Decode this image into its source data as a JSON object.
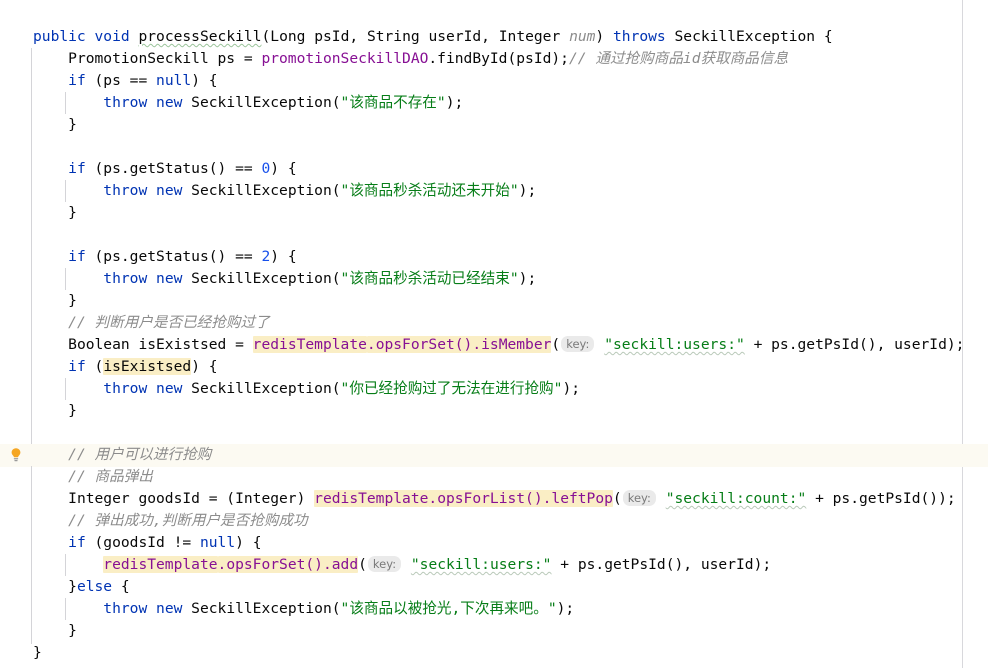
{
  "editor": {
    "language": "java",
    "theme": "IntelliJ Light",
    "colors": {
      "background": "#ffffff",
      "foreground": "#080808",
      "keyword": "#0033b3",
      "string": "#067d17",
      "number": "#1750eb",
      "comment": "#8c8c8c",
      "field": "#871094",
      "identifier_highlight": "#faeec5",
      "caret_row": "#fcfaf2",
      "inlay_hint_bg": "#eaeaea",
      "inlay_hint_fg": "#7a7a7a",
      "indent_guide": "#d4d4d8",
      "wrap_guide": "#d8d8dc",
      "bulb": "#f5a623"
    },
    "gutter": {
      "intention_bulb": "lightbulb-icon"
    }
  },
  "code": {
    "lines": [
      {
        "n": 1,
        "indent": 0,
        "tokens": [
          {
            "t": "public",
            "c": "kw"
          },
          {
            "t": " ",
            "c": "punct"
          },
          {
            "t": "void",
            "c": "kw"
          },
          {
            "t": " ",
            "c": "punct"
          },
          {
            "t": "processSeckill",
            "c": "ident wavy-green"
          },
          {
            "t": "(",
            "c": "punct"
          },
          {
            "t": "Long",
            "c": "type"
          },
          {
            "t": " psId, ",
            "c": "punct"
          },
          {
            "t": "String",
            "c": "type"
          },
          {
            "t": " userId, ",
            "c": "punct"
          },
          {
            "t": "Integer",
            "c": "type"
          },
          {
            "t": " ",
            "c": "punct"
          },
          {
            "t": "num",
            "c": "cmt-grey"
          },
          {
            "t": ") ",
            "c": "punct"
          },
          {
            "t": "throws",
            "c": "kw"
          },
          {
            "t": " SeckillException {",
            "c": "punct"
          }
        ]
      },
      {
        "n": 2,
        "indent": 1,
        "tokens": [
          {
            "t": "PromotionSeckill ps = ",
            "c": "punct"
          },
          {
            "t": "promotionSeckillDAO",
            "c": "field"
          },
          {
            "t": ".findById(psId);",
            "c": "punct"
          },
          {
            "t": "// ",
            "c": "cmt"
          },
          {
            "t": "通过抢购商品id获取商品信息",
            "c": "cmt cjk"
          }
        ]
      },
      {
        "n": 3,
        "indent": 1,
        "tokens": [
          {
            "t": "if",
            "c": "kw"
          },
          {
            "t": " (ps == ",
            "c": "punct"
          },
          {
            "t": "null",
            "c": "kw"
          },
          {
            "t": ") {",
            "c": "punct"
          }
        ]
      },
      {
        "n": 4,
        "indent": 2,
        "tokens": [
          {
            "t": "throw",
            "c": "kw"
          },
          {
            "t": " ",
            "c": "punct"
          },
          {
            "t": "new",
            "c": "kw"
          },
          {
            "t": " SeckillException(",
            "c": "punct"
          },
          {
            "t": "\"该商品不存在\"",
            "c": "str cjk"
          },
          {
            "t": ");",
            "c": "punct"
          }
        ]
      },
      {
        "n": 5,
        "indent": 1,
        "tokens": [
          {
            "t": "}",
            "c": "punct"
          }
        ]
      },
      {
        "n": 6,
        "indent": 0,
        "tokens": []
      },
      {
        "n": 7,
        "indent": 1,
        "tokens": [
          {
            "t": "if",
            "c": "kw"
          },
          {
            "t": " (ps.getStatus() == ",
            "c": "punct"
          },
          {
            "t": "0",
            "c": "num"
          },
          {
            "t": ") {",
            "c": "punct"
          }
        ]
      },
      {
        "n": 8,
        "indent": 2,
        "tokens": [
          {
            "t": "throw",
            "c": "kw"
          },
          {
            "t": " ",
            "c": "punct"
          },
          {
            "t": "new",
            "c": "kw"
          },
          {
            "t": " SeckillException(",
            "c": "punct"
          },
          {
            "t": "\"该商品秒杀活动还未开始\"",
            "c": "str cjk"
          },
          {
            "t": ");",
            "c": "punct"
          }
        ]
      },
      {
        "n": 9,
        "indent": 1,
        "tokens": [
          {
            "t": "}",
            "c": "punct"
          }
        ]
      },
      {
        "n": 10,
        "indent": 0,
        "tokens": []
      },
      {
        "n": 11,
        "indent": 1,
        "tokens": [
          {
            "t": "if",
            "c": "kw"
          },
          {
            "t": " (ps.getStatus() == ",
            "c": "punct"
          },
          {
            "t": "2",
            "c": "num"
          },
          {
            "t": ") {",
            "c": "punct"
          }
        ]
      },
      {
        "n": 12,
        "indent": 2,
        "tokens": [
          {
            "t": "throw",
            "c": "kw"
          },
          {
            "t": " ",
            "c": "punct"
          },
          {
            "t": "new",
            "c": "kw"
          },
          {
            "t": " SeckillException(",
            "c": "punct"
          },
          {
            "t": "\"该商品秒杀活动已经结束\"",
            "c": "str cjk"
          },
          {
            "t": ");",
            "c": "punct"
          }
        ]
      },
      {
        "n": 13,
        "indent": 1,
        "tokens": [
          {
            "t": "}",
            "c": "punct"
          }
        ]
      },
      {
        "n": 14,
        "indent": 1,
        "tokens": [
          {
            "t": "// ",
            "c": "cmt"
          },
          {
            "t": "判断用户是否已经抢购过了",
            "c": "cmt cjk"
          }
        ]
      },
      {
        "n": 15,
        "indent": 1,
        "tokens": [
          {
            "t": "Boolean isExistsed = ",
            "c": "punct"
          },
          {
            "t": "redisTemplate",
            "c": "field hl"
          },
          {
            "t": ".opsForSet().isMember",
            "c": "field hl"
          },
          {
            "t": "(",
            "c": "punct"
          },
          {
            "t": "key:",
            "c": "hint"
          },
          {
            "t": " ",
            "c": "punct"
          },
          {
            "t": "\"seckill:users:\"",
            "c": "str wavy-grey"
          },
          {
            "t": " + ps.getPsId(), userId);",
            "c": "punct"
          }
        ]
      },
      {
        "n": 16,
        "indent": 1,
        "tokens": [
          {
            "t": "if",
            "c": "kw"
          },
          {
            "t": " (",
            "c": "punct"
          },
          {
            "t": "isExistsed",
            "c": "ident hl"
          },
          {
            "t": ") {",
            "c": "punct"
          }
        ]
      },
      {
        "n": 17,
        "indent": 2,
        "tokens": [
          {
            "t": "throw",
            "c": "kw"
          },
          {
            "t": " ",
            "c": "punct"
          },
          {
            "t": "new",
            "c": "kw"
          },
          {
            "t": " SeckillException(",
            "c": "punct"
          },
          {
            "t": "\"你已经抢购过了无法在进行抢购\"",
            "c": "str cjk"
          },
          {
            "t": ");",
            "c": "punct"
          }
        ]
      },
      {
        "n": 18,
        "indent": 1,
        "tokens": [
          {
            "t": "}",
            "c": "punct"
          }
        ]
      },
      {
        "n": 19,
        "indent": 0,
        "tokens": []
      },
      {
        "n": 20,
        "indent": 1,
        "caret": true,
        "tokens": [
          {
            "t": "// ",
            "c": "cmt"
          },
          {
            "t": "用户可以进行抢购",
            "c": "cmt cjk"
          }
        ]
      },
      {
        "n": 21,
        "indent": 1,
        "tokens": [
          {
            "t": "// ",
            "c": "cmt"
          },
          {
            "t": "商品弹出",
            "c": "cmt cjk"
          }
        ]
      },
      {
        "n": 22,
        "indent": 1,
        "tokens": [
          {
            "t": "Integer goodsId = (Integer) ",
            "c": "punct"
          },
          {
            "t": "redisTemplate",
            "c": "field hl"
          },
          {
            "t": ".opsForList().leftPop",
            "c": "field hl"
          },
          {
            "t": "(",
            "c": "punct"
          },
          {
            "t": "key:",
            "c": "hint"
          },
          {
            "t": " ",
            "c": "punct"
          },
          {
            "t": "\"seckill:count:\"",
            "c": "str wavy-grey"
          },
          {
            "t": " + ps.getPsId());",
            "c": "punct"
          }
        ]
      },
      {
        "n": 23,
        "indent": 1,
        "tokens": [
          {
            "t": "// ",
            "c": "cmt"
          },
          {
            "t": "弹出成功,判断用户是否抢购成功",
            "c": "cmt cjk"
          }
        ]
      },
      {
        "n": 24,
        "indent": 1,
        "tokens": [
          {
            "t": "if",
            "c": "kw"
          },
          {
            "t": " (goodsId != ",
            "c": "punct"
          },
          {
            "t": "null",
            "c": "kw"
          },
          {
            "t": ") {",
            "c": "punct"
          }
        ]
      },
      {
        "n": 25,
        "indent": 2,
        "tokens": [
          {
            "t": "redisTemplate",
            "c": "field hl"
          },
          {
            "t": ".opsForSet().add",
            "c": "field hl"
          },
          {
            "t": "(",
            "c": "punct"
          },
          {
            "t": "key:",
            "c": "hint"
          },
          {
            "t": " ",
            "c": "punct"
          },
          {
            "t": "\"seckill:users:\"",
            "c": "str wavy-grey"
          },
          {
            "t": " + ps.getPsId(), userId);",
            "c": "punct"
          }
        ]
      },
      {
        "n": 26,
        "indent": 1,
        "tokens": [
          {
            "t": "}",
            "c": "punct"
          },
          {
            "t": "else",
            "c": "kw"
          },
          {
            "t": " {",
            "c": "punct"
          }
        ]
      },
      {
        "n": 27,
        "indent": 2,
        "tokens": [
          {
            "t": "throw",
            "c": "kw"
          },
          {
            "t": " ",
            "c": "punct"
          },
          {
            "t": "new",
            "c": "kw"
          },
          {
            "t": " SeckillException(",
            "c": "punct"
          },
          {
            "t": "\"该商品以被抢光,下次再来吧。\"",
            "c": "str cjk"
          },
          {
            "t": ");",
            "c": "punct"
          }
        ]
      },
      {
        "n": 28,
        "indent": 1,
        "tokens": [
          {
            "t": "}",
            "c": "punct"
          }
        ]
      },
      {
        "n": 29,
        "indent": 0,
        "tokens": [
          {
            "t": "}",
            "c": "punct"
          }
        ]
      }
    ]
  }
}
